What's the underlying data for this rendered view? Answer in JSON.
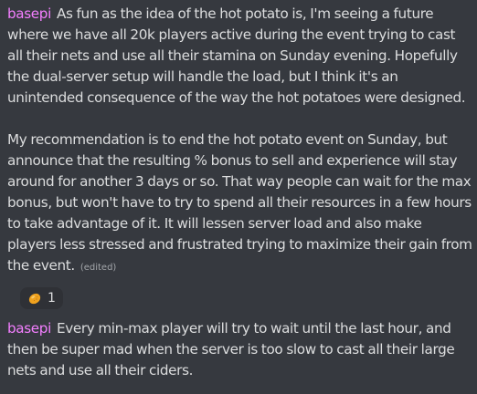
{
  "messages": [
    {
      "author": "basepi",
      "paragraphs": [
        "As fun as the idea of the hot potato is, I'm seeing a future where we have all 20k players active during the event trying to cast all their nets and use all their stamina on Sunday evening. Hopefully the dual-server setup will handle the load, but I think it's an unintended consequence of the way the hot potatoes were designed.",
        "My recommendation is to end the hot potato event on Sunday, but announce that the resulting % bonus to sell and experience will stay around for another 3 days or so. That way people can wait for the max bonus, but won't have to try to spend all their resources in a few hours to take advantage of it. It will lessen server load and also make players less stressed and frustrated trying to maximize their gain from the event."
      ],
      "edited_label": "(edited)",
      "reaction": {
        "emoji": "potato-emoji-icon",
        "count": "1"
      }
    },
    {
      "author": "basepi",
      "paragraphs": [
        "Every min-max player will try to wait until the last hour, and then be super mad when the server is too slow to cast all their large nets and use all their ciders."
      ]
    }
  ],
  "colors": {
    "background": "#36393f",
    "text": "#dcddde",
    "author": "#f47fff",
    "muted": "#a3a6aa",
    "reaction_bg": "#2f3136"
  }
}
